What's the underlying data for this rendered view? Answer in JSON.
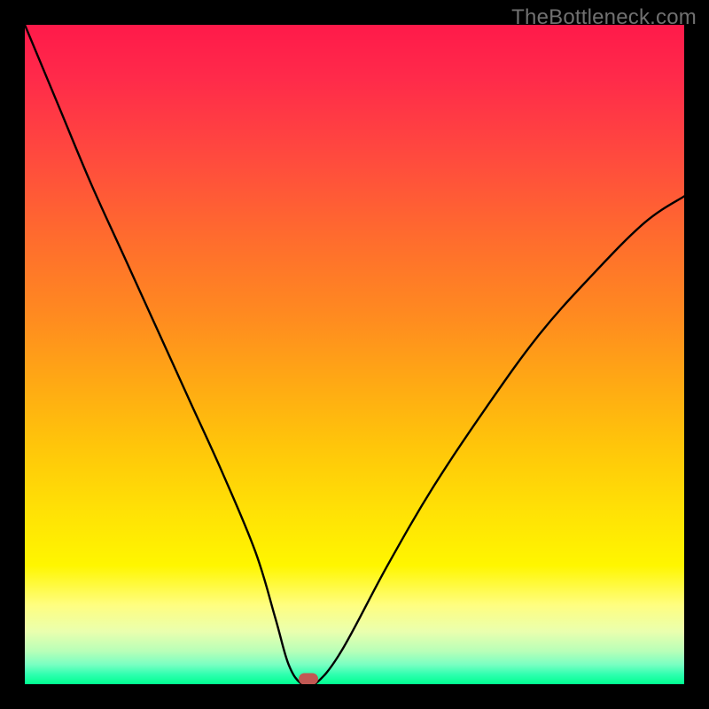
{
  "watermark": "TheBottleneck.com",
  "chart_data": {
    "type": "line",
    "title": "",
    "xlabel": "",
    "ylabel": "",
    "xlim": [
      0,
      100
    ],
    "ylim": [
      0,
      100
    ],
    "grid": false,
    "legend": false,
    "series": [
      {
        "name": "bottleneck-curve",
        "x": [
          0,
          5,
          10,
          15,
          20,
          25,
          30,
          35,
          38,
          40,
          42,
          44,
          48,
          55,
          62,
          70,
          78,
          86,
          94,
          100
        ],
        "values": [
          100,
          88,
          76,
          65,
          54,
          43,
          32,
          20,
          10,
          3,
          0,
          0,
          5,
          18,
          30,
          42,
          53,
          62,
          70,
          74
        ]
      }
    ],
    "annotations": [
      {
        "name": "optimal-marker",
        "x": 43,
        "y": 0.5,
        "shape": "rounded-rect",
        "color": "#c15853"
      }
    ],
    "background_gradient": {
      "orientation": "vertical",
      "stops": [
        {
          "pos": 0,
          "color": "#ff1a4a"
        },
        {
          "pos": 0.5,
          "color": "#ffb010"
        },
        {
          "pos": 0.82,
          "color": "#fff600"
        },
        {
          "pos": 1.0,
          "color": "#00ff90"
        }
      ]
    }
  },
  "marker": {
    "left_pct": 43.0,
    "top_pct": 99.2
  }
}
